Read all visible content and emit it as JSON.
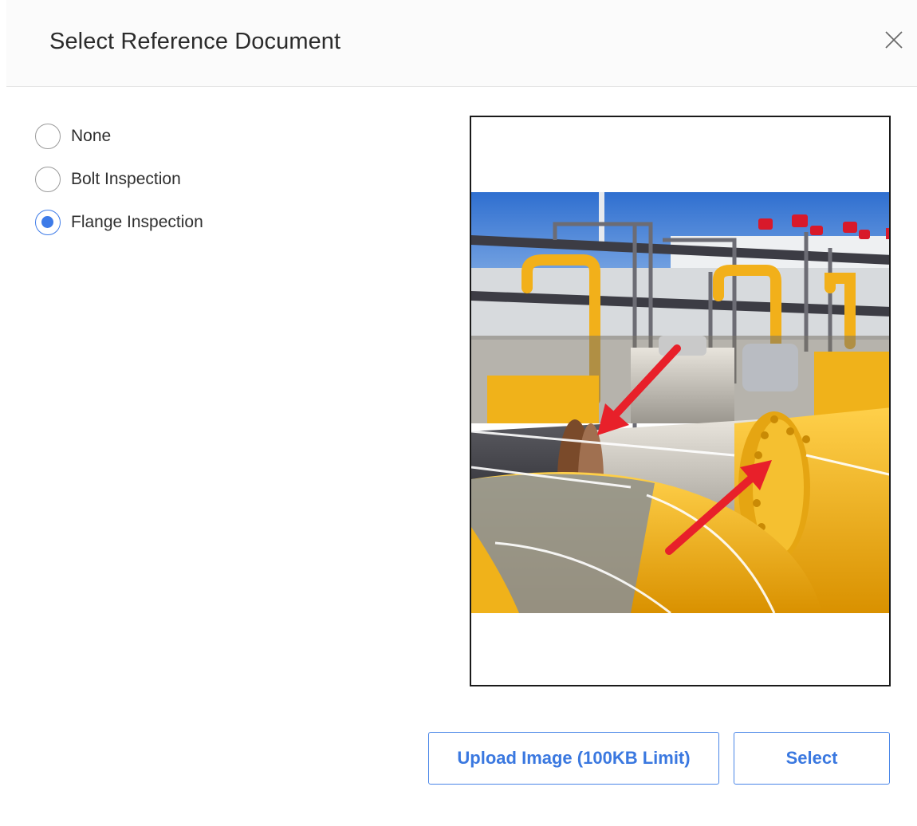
{
  "dialog": {
    "title": "Select Reference Document",
    "close_icon": "close-icon"
  },
  "options": [
    {
      "label": "None",
      "checked": false
    },
    {
      "label": "Bolt Inspection",
      "checked": false
    },
    {
      "label": "Flange Inspection",
      "checked": true
    }
  ],
  "preview": {
    "image_icon": "pipeline-flange-photo"
  },
  "buttons": {
    "upload_label": "Upload Image (100KB Limit)",
    "select_label": "Select"
  },
  "colors": {
    "accent": "#3d7be8",
    "button_text": "#3a78e0",
    "pipe_yellow": "#f0b21a",
    "arrow_red": "#e8202a"
  }
}
